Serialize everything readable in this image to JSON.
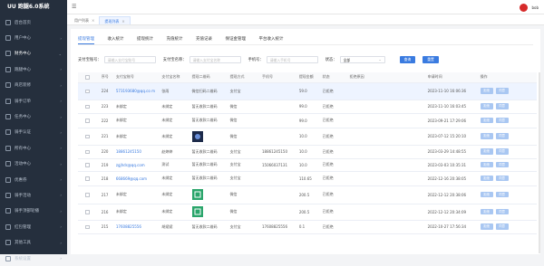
{
  "app": {
    "title": "UU 跑腿6.0系统"
  },
  "sidebar": {
    "items": [
      {
        "label": "后台首页",
        "arrow": "",
        "active": false
      },
      {
        "label": "用户中心",
        "arrow": "›",
        "active": false
      },
      {
        "label": "财务中心",
        "arrow": "⌄",
        "active": true
      },
      {
        "label": "跑腿中心",
        "arrow": "›",
        "active": false
      },
      {
        "label": "商店装修",
        "arrow": "›",
        "active": false
      },
      {
        "label": "骑手订单",
        "arrow": "›",
        "active": false
      },
      {
        "label": "任务中心",
        "arrow": "›",
        "active": false
      },
      {
        "label": "骑手认证",
        "arrow": "›",
        "active": false
      },
      {
        "label": "所有中心",
        "arrow": "›",
        "active": false
      },
      {
        "label": "活动中心",
        "arrow": "›",
        "active": false
      },
      {
        "label": "优惠券",
        "arrow": "›",
        "active": false
      },
      {
        "label": "骑手活动",
        "arrow": "›",
        "active": false
      },
      {
        "label": "骑手顶部轮播",
        "arrow": "›",
        "active": false
      },
      {
        "label": "红包管理",
        "arrow": "›",
        "active": false
      },
      {
        "label": "其他工具",
        "arrow": "›",
        "active": false
      },
      {
        "label": "系统设置",
        "arrow": "›",
        "active": false
      }
    ]
  },
  "header": {
    "username": "bob"
  },
  "tags": [
    {
      "label": "用户列表",
      "closable": true,
      "active": false
    },
    {
      "label": "提现列表",
      "closable": true,
      "active": true
    }
  ],
  "tabs": [
    "提现管理",
    "收入统计",
    "提现统计",
    "充值统计",
    "充值记录",
    "保证金管理",
    "平台收入统计"
  ],
  "filters": {
    "account_label": "支付宝账号：",
    "account_placeholder": "请输入支付宝账号",
    "name_label": "支付宝名称：",
    "name_placeholder": "请输入支付宝名称",
    "phone_label": "手机号：",
    "phone_placeholder": "请输入手机号",
    "status_label": "状态：",
    "status_value": "全部",
    "search_button": "查询",
    "reset_button": "重置"
  },
  "table": {
    "columns": [
      "序号",
      "支付宝账号",
      "支付宝名称",
      "提现二维码",
      "提现方式",
      "手机号",
      "提现金额",
      "状态",
      "拒绝原因",
      "申请时间",
      "操作"
    ],
    "rows": [
      {
        "id": "224",
        "account": "573193680@qq.co m",
        "name": "张雨",
        "qr": "微信扫码二维码",
        "method": "支付宝",
        "phone": "",
        "amount": "59.0",
        "status": "已拒绝",
        "reason": "",
        "time": "2023-11-10 16:06:36",
        "ops": [
          "拒绝",
          "同意"
        ]
      },
      {
        "id": "223",
        "account": "未绑定",
        "name": "未绑定",
        "qr": "暂无收款二维码",
        "method": "微信",
        "phone": "",
        "amount": "99.0",
        "status": "已拒绝",
        "reason": "",
        "time": "2023-11-10 16:03:45",
        "ops": [
          "拒绝",
          "同意"
        ]
      },
      {
        "id": "222",
        "account": "未绑定",
        "name": "未绑定",
        "qr": "暂无收款二维码",
        "method": "微信",
        "phone": "",
        "amount": "99.0",
        "status": "已拒绝",
        "reason": "",
        "time": "2023-09-21 17:29:06",
        "ops": [
          "拒绝",
          "同意"
        ]
      },
      {
        "id": "221",
        "account": "未绑定",
        "name": "未绑定",
        "qr": "",
        "method": "微信",
        "phone": "",
        "amount": "10.0",
        "status": "已拒绝",
        "reason": "",
        "time": "2023-07-12 15:20:10",
        "ops": [
          "拒绝",
          "同意"
        ]
      },
      {
        "id": "220",
        "account": "18861245150",
        "name": "赵婷婷",
        "qr": "暂无收款二维码",
        "method": "支付宝",
        "phone": "18861245150",
        "amount": "10.0",
        "status": "已拒绝",
        "reason": "",
        "time": "2023-03-29 14:48:55",
        "ops": [
          "拒绝",
          "同意"
        ]
      },
      {
        "id": "219",
        "account": "zgjhds@qq.com",
        "name": "测试",
        "qr": "暂无收款二维码",
        "method": "支付宝",
        "phone": "15066037131",
        "amount": "10.0",
        "status": "已拒绝",
        "reason": "",
        "time": "2023-03-03 10:35:31",
        "ops": [
          "拒绝",
          "同意"
        ]
      },
      {
        "id": "218",
        "account": "668669@qq.com",
        "name": "未绑定",
        "qr": "暂无收款二维码",
        "method": "支付宝",
        "phone": "",
        "amount": "110.65",
        "status": "已拒绝",
        "reason": "",
        "time": "2022-12-16 20:38:05",
        "ops": [
          "拒绝",
          "同意"
        ]
      },
      {
        "id": "217",
        "account": "未绑定",
        "name": "未绑定",
        "qr": "",
        "method": "微信",
        "phone": "",
        "amount": "200.5",
        "status": "已拒绝",
        "reason": "",
        "time": "2022-12-12 20:38:06",
        "ops": [
          "拒绝",
          "同意"
        ]
      },
      {
        "id": "216",
        "account": "未绑定",
        "name": "未绑定",
        "qr": "",
        "method": "微信",
        "phone": "",
        "amount": "200.5",
        "status": "已拒绝",
        "reason": "",
        "time": "2022-12-12 20:34:09",
        "ops": [
          "拒绝",
          "同意"
        ]
      },
      {
        "id": "215",
        "account": "17608825556",
        "name": "胡斌斌",
        "qr": "暂无收款二维码",
        "method": "支付宝",
        "phone": "17608825556",
        "amount": "0.1",
        "status": "已拒绝",
        "reason": "",
        "time": "2022-10-27 17:56:34",
        "ops": [
          "拒绝",
          "同意"
        ]
      }
    ]
  },
  "colors": {
    "sidebar_bg": "#252f3d",
    "accent": "#3a7be0",
    "button_light": "#a9c7f2",
    "avatar": "#d62a2a"
  }
}
